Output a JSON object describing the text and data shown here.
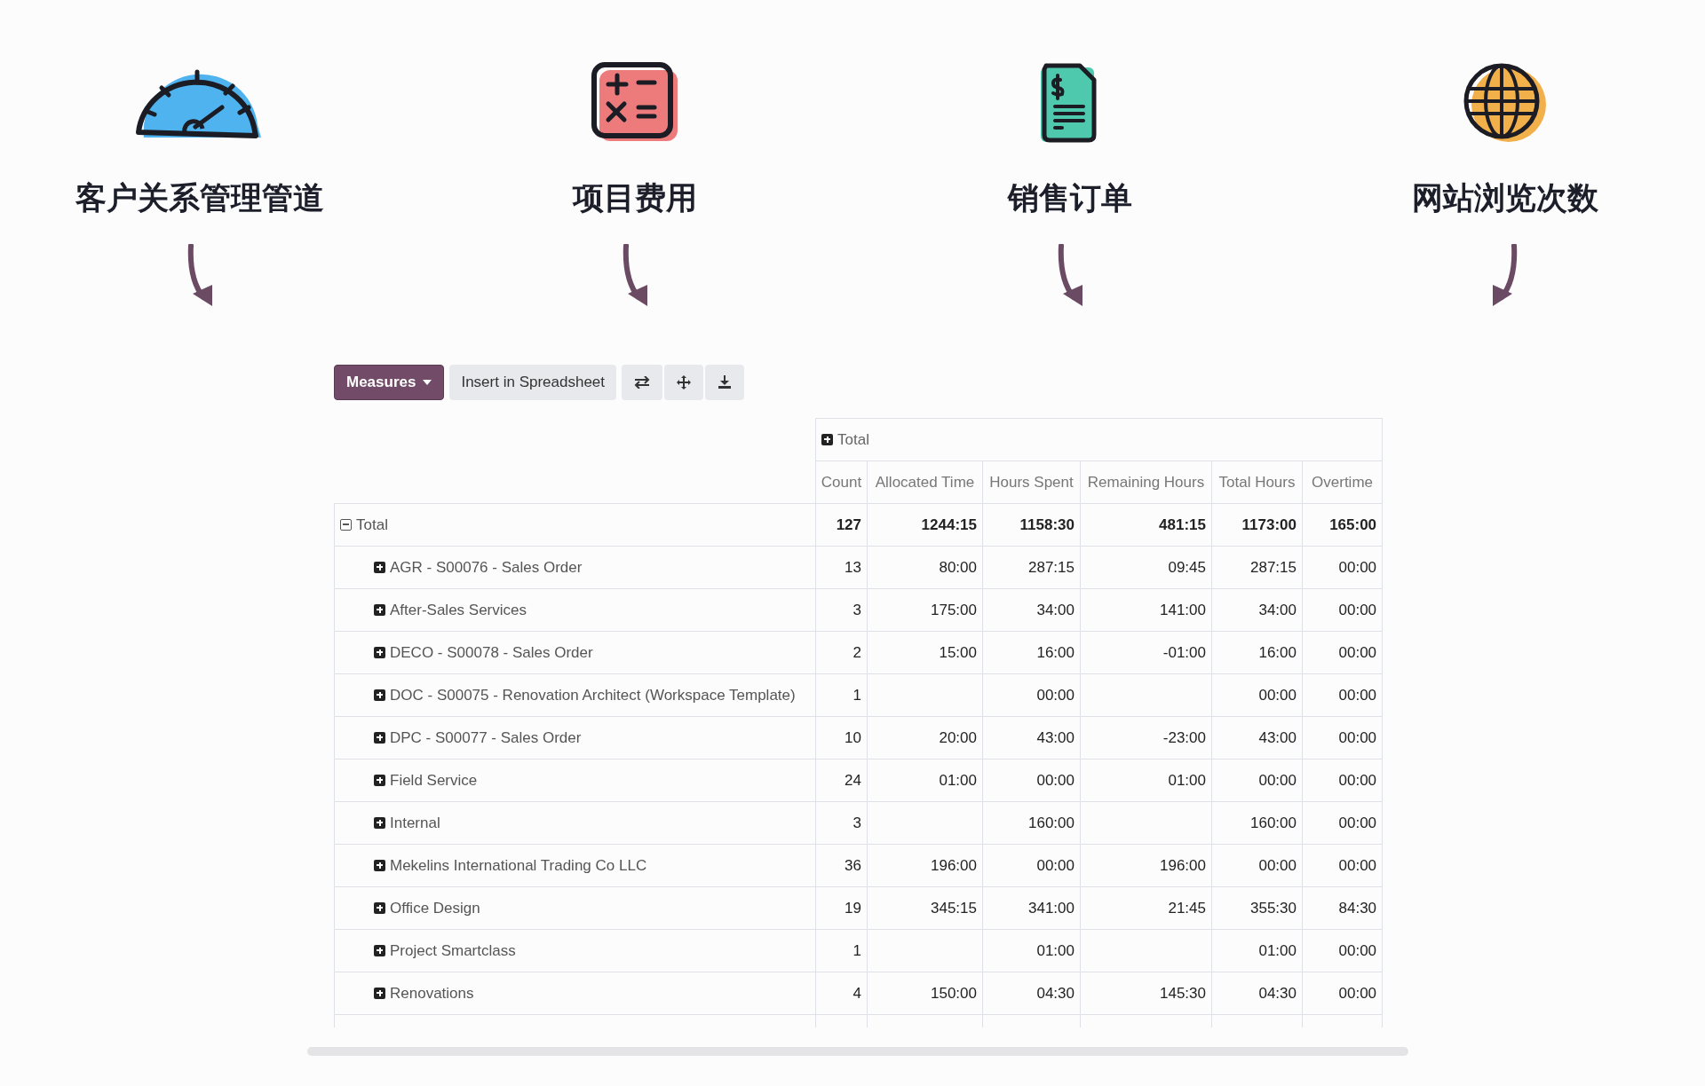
{
  "features": [
    {
      "label": "客户关系管理管道"
    },
    {
      "label": "项目费用"
    },
    {
      "label": "销售订单"
    },
    {
      "label": "网站浏览次数"
    }
  ],
  "toolbar": {
    "measures": "Measures",
    "insert": "Insert in Spreadsheet"
  },
  "pivot": {
    "column_header": {
      "label": "Total",
      "expanded": false
    },
    "measures": [
      "Count",
      "Allocated Time",
      "Hours Spent",
      "Remaining Hours",
      "Total Hours",
      "Overtime"
    ],
    "total": {
      "label": "Total",
      "expanded": true,
      "count": "127",
      "allocated_time": "1244:15",
      "hours_spent": "1158:30",
      "remaining_hours": "481:15",
      "total_hours": "1173:00",
      "overtime": "165:00"
    },
    "rows": [
      {
        "label": "AGR - S00076 - Sales Order",
        "expanded": false,
        "count": "13",
        "allocated_time": "80:00",
        "hours_spent": "287:15",
        "remaining_hours": "09:45",
        "total_hours": "287:15",
        "overtime": "00:00"
      },
      {
        "label": "After-Sales Services",
        "expanded": false,
        "count": "3",
        "allocated_time": "175:00",
        "hours_spent": "34:00",
        "remaining_hours": "141:00",
        "total_hours": "34:00",
        "overtime": "00:00"
      },
      {
        "label": "DECO - S00078 - Sales Order",
        "expanded": false,
        "count": "2",
        "allocated_time": "15:00",
        "hours_spent": "16:00",
        "remaining_hours": "-01:00",
        "total_hours": "16:00",
        "overtime": "00:00"
      },
      {
        "label": "DOC - S00075 - Renovation Architect (Workspace Template)",
        "expanded": false,
        "count": "1",
        "hours_spent": "00:00",
        "total_hours": "00:00",
        "overtime": "00:00"
      },
      {
        "label": "DPC - S00077 - Sales Order",
        "expanded": false,
        "count": "10",
        "allocated_time": "20:00",
        "hours_spent": "43:00",
        "remaining_hours": "-23:00",
        "total_hours": "43:00",
        "overtime": "00:00"
      },
      {
        "label": "Field Service",
        "expanded": false,
        "count": "24",
        "allocated_time": "01:00",
        "hours_spent": "00:00",
        "remaining_hours": "01:00",
        "total_hours": "00:00",
        "overtime": "00:00"
      },
      {
        "label": "Internal",
        "expanded": false,
        "count": "3",
        "hours_spent": "160:00",
        "total_hours": "160:00",
        "overtime": "00:00"
      },
      {
        "label": "Mekelins International Trading Co LLC",
        "expanded": false,
        "count": "36",
        "allocated_time": "196:00",
        "hours_spent": "00:00",
        "remaining_hours": "196:00",
        "total_hours": "00:00",
        "overtime": "00:00"
      },
      {
        "label": "Office Design",
        "expanded": false,
        "count": "19",
        "allocated_time": "345:15",
        "hours_spent": "341:00",
        "remaining_hours": "21:45",
        "total_hours": "355:30",
        "overtime": "84:30"
      },
      {
        "label": "Project Smartclass",
        "expanded": false,
        "count": "1",
        "hours_spent": "01:00",
        "total_hours": "01:00",
        "overtime": "00:00"
      },
      {
        "label": "Renovations",
        "expanded": false,
        "count": "4",
        "allocated_time": "150:00",
        "hours_spent": "04:30",
        "remaining_hours": "145:30",
        "total_hours": "04:30",
        "overtime": "00:00"
      }
    ]
  }
}
